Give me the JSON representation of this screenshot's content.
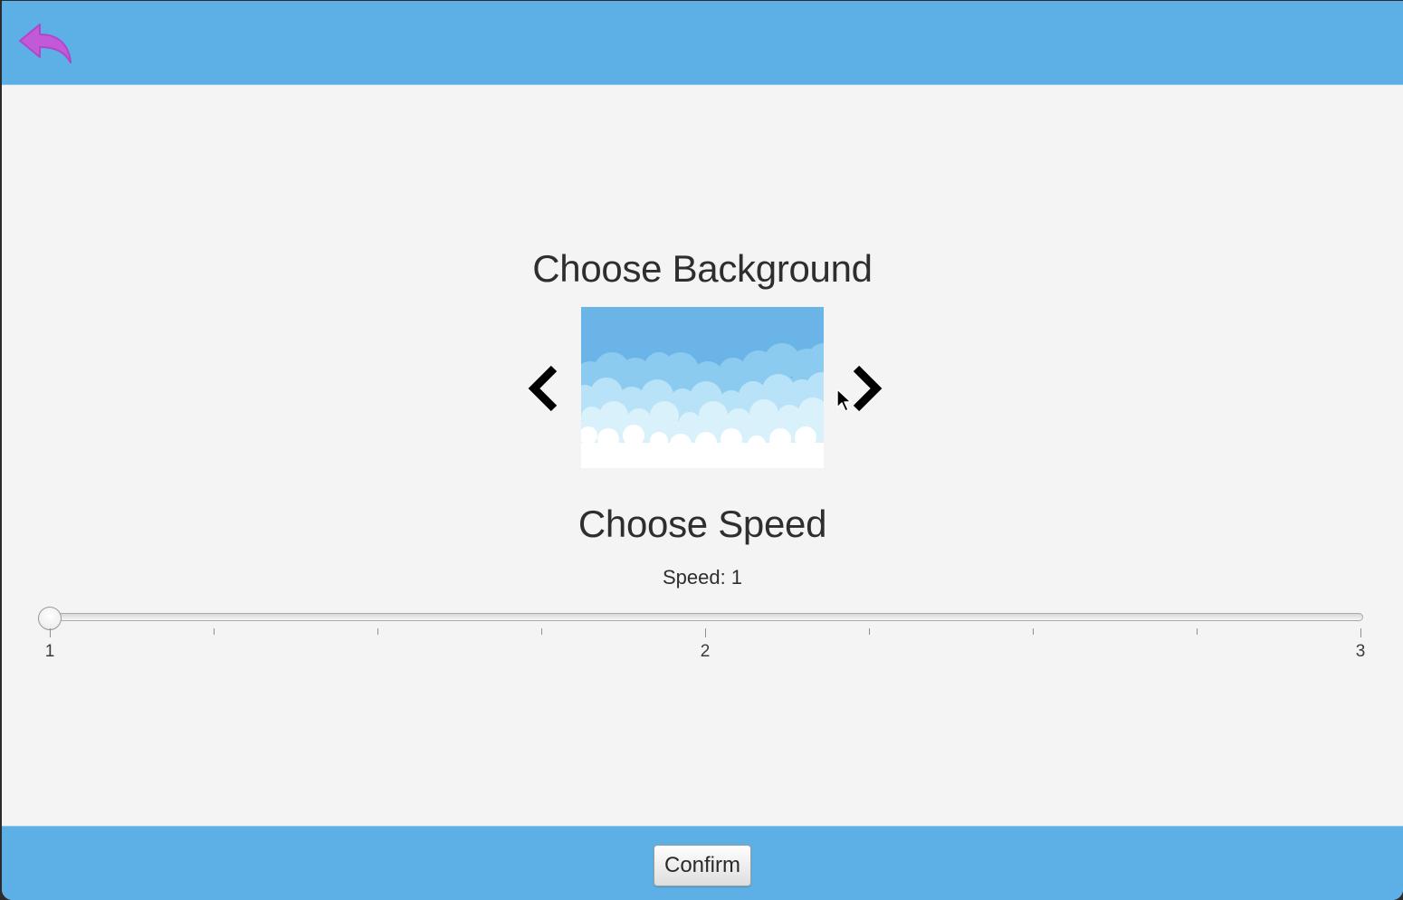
{
  "header": {
    "back_icon": "back-arrow-icon",
    "back_icon_color": "#c25ad8",
    "bar_color": "#5db0e6"
  },
  "background_picker": {
    "title": "Choose Background",
    "prev_icon": "chevron-left-icon",
    "next_icon": "chevron-right-icon",
    "preview_image": "sky-clouds-background"
  },
  "speed": {
    "title": "Choose Speed",
    "label": "Speed: 1",
    "value": 1,
    "min": 1,
    "max": 3,
    "tick_labels": [
      "1",
      "2",
      "3"
    ],
    "minor_ticks_between_labels": 3
  },
  "footer": {
    "confirm_label": "Confirm"
  }
}
